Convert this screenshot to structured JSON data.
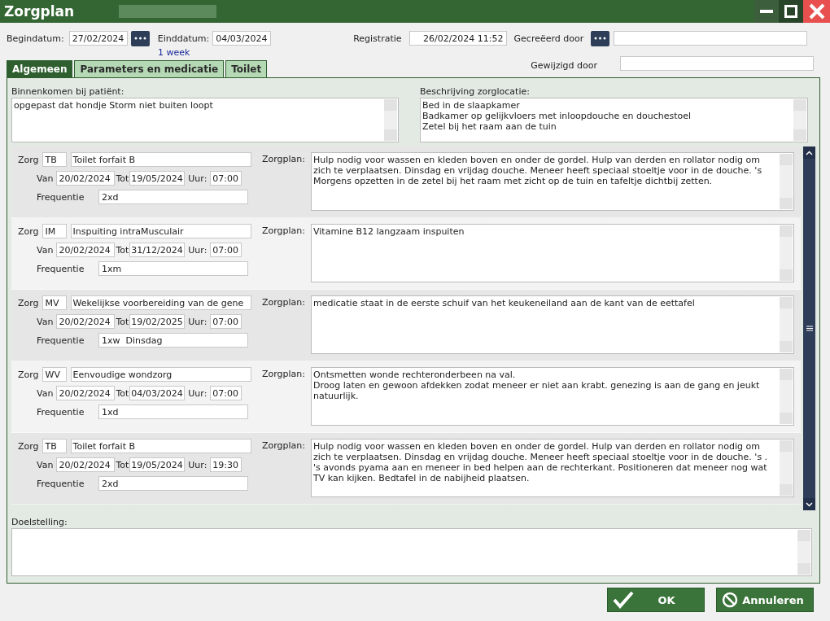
{
  "window": {
    "title": "Zorgplan"
  },
  "header": {
    "begindatum": {
      "label": "Begindatum:",
      "value": "27/02/2024"
    },
    "einddatum": {
      "label": "Einddatum:",
      "value": "04/03/2024"
    },
    "duration": "1 week",
    "registratie": {
      "label": "Registratie",
      "value": "26/02/2024 11:52"
    },
    "gecreeerd_door": {
      "label": "Gecreëerd door"
    },
    "gewijzigd_door": {
      "label": "Gewijzigd door"
    }
  },
  "tabs": [
    {
      "label": "Algemeen",
      "selected": true
    },
    {
      "label": "Parameters en medicatie",
      "selected": false
    },
    {
      "label": "Toilet",
      "selected": false
    }
  ],
  "binnenkomen": {
    "label": "Binnenkomen bij patiënt:",
    "value": "opgepast dat hondje Storm niet buiten loopt"
  },
  "beschrijving": {
    "label": "Beschrijving zorglocatie:",
    "value": "Bed in de slaapkamer\nBadkamer op gelijkvloers met inloopdouche en douchestoel\nZetel bij het raam aan de tuin"
  },
  "care_items": [
    {
      "zorg_label": "Zorg",
      "code": "TB",
      "name": "Toilet forfait B",
      "van_label": "Van",
      "van": "20/02/2024",
      "tot_label": "Tot",
      "tot": "19/05/2024",
      "uur_label": "Uur:",
      "uur": "07:00",
      "frequentie_label": "Frequentie",
      "frequentie": "2xd",
      "zorgplan_label": "Zorgplan:",
      "zorgplan": "Hulp nodig voor wassen en kleden boven en onder de gordel. Hulp van derden en rollator nodig om zich te verplaatsen. Dinsdag en vrijdag douche. Meneer heeft speciaal stoeltje voor in de douche. 's Morgens opzetten in de zetel bij het raam met zicht op de tuin en tafeltje dichtbij zetten."
    },
    {
      "zorg_label": "Zorg",
      "code": "IM",
      "name": "Inspuiting intraMusculair",
      "van_label": "Van",
      "van": "20/02/2024",
      "tot_label": "Tot",
      "tot": "31/12/2024",
      "uur_label": "Uur:",
      "uur": "07:00",
      "frequentie_label": "Frequentie",
      "frequentie": "1xm",
      "zorgplan_label": "Zorgplan:",
      "zorgplan": "Vitamine B12 langzaam inspuiten"
    },
    {
      "zorg_label": "Zorg",
      "code": "MV",
      "name": "Wekelijkse voorbereiding van de gene",
      "van_label": "Van",
      "van": "20/02/2024",
      "tot_label": "Tot",
      "tot": "19/02/2025",
      "uur_label": "Uur:",
      "uur": "07:00",
      "frequentie_label": "Frequentie",
      "frequentie": "1xw  Dinsdag",
      "zorgplan_label": "Zorgplan:",
      "zorgplan": "medicatie staat in de eerste schuif van het keukeneiland aan de kant van de eettafel"
    },
    {
      "zorg_label": "Zorg",
      "code": "WV",
      "name": "Eenvoudige wondzorg",
      "van_label": "Van",
      "van": "20/02/2024",
      "tot_label": "Tot",
      "tot": "04/03/2024",
      "uur_label": "Uur:",
      "uur": "07:00",
      "frequentie_label": "Frequentie",
      "frequentie": "1xd",
      "zorgplan_label": "Zorgplan:",
      "zorgplan": "Ontsmetten wonde rechteronderbeen na val.\nDroog laten en gewoon afdekken zodat meneer er niet aan krabt. genezing is aan de gang en jeukt natuurlijk."
    },
    {
      "zorg_label": "Zorg",
      "code": "TB",
      "name": "Toilet forfait B",
      "van_label": "Van",
      "van": "20/02/2024",
      "tot_label": "Tot",
      "tot": "19/05/2024",
      "uur_label": "Uur:",
      "uur": "19:30",
      "frequentie_label": "Frequentie",
      "frequentie": "2xd",
      "zorgplan_label": "Zorgplan:",
      "zorgplan": "Hulp nodig voor wassen en kleden boven en onder de gordel. Hulp van derden en rollator nodig om zich te verplaatsen. Dinsdag en vrijdag douche. Meneer heeft speciaal stoeltje voor in de douche. 's .\n's avonds pyama aan en meneer in bed helpen aan de rechterkant. Positioneren dat meneer nog wat TV kan kijken. Bedtafel in de nabijheid plaatsen."
    }
  ],
  "doelstelling": {
    "label": "Doelstelling:"
  },
  "buttons": [
    {
      "kind": "ok",
      "label": "OK"
    },
    {
      "kind": "cancel",
      "label": "Annuleren"
    }
  ]
}
